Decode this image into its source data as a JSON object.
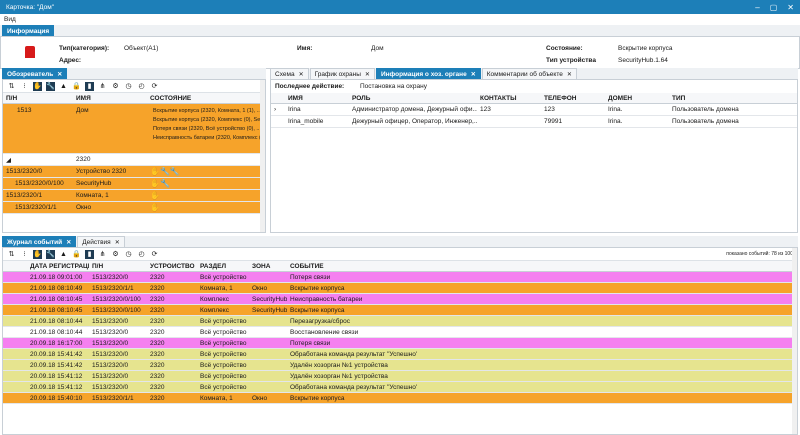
{
  "window": {
    "title": "Карточка: \"Дом\"",
    "min": "–",
    "max": "▢",
    "close": "✕"
  },
  "menu": {
    "view": "Вид"
  },
  "top_tab": {
    "label": "Информация"
  },
  "info": {
    "type_label": "Тип(категория):",
    "type_value": "Объект(А1)",
    "address_label": "Адрес:",
    "name_label": "Имя:",
    "name_value": "Дом",
    "state_label": "Состояние:",
    "state_value": "Вскрытие корпуса",
    "device_type_label": "Тип устройства",
    "device_type_value": "SecurityHub.1.64"
  },
  "left_tabs": [
    {
      "label": "Обозреватель",
      "close": "✕"
    }
  ],
  "right_tabs": [
    {
      "label": "Схема",
      "close": "✕"
    },
    {
      "label": "График охраны",
      "close": "✕"
    },
    {
      "label": "Информация о хоз. органе",
      "close": "✕"
    },
    {
      "label": "Комментарии об объекте",
      "close": "✕"
    }
  ],
  "tree": {
    "headers": [
      "П/Н",
      "ИМЯ",
      "СОСТОЯНИЕ"
    ],
    "rows": [
      {
        "num": "1513",
        "name": "Дом",
        "states": [
          "Вскрытие корпуса (2320, Комната, 1 (1), ...",
          "Вскрытие корпуса (2320, Комплекс (0), Se...",
          "Потеря связи (2320, Всё устройство (0), ...",
          "Неисправность батареи (2320, Комплекс (0)..."
        ],
        "color": "orange"
      },
      {
        "num": "",
        "name": "2320",
        "states": [],
        "color": "white"
      },
      {
        "num": "1513/2320/0",
        "name": "Устройство 2320",
        "states": [],
        "color": "orange"
      },
      {
        "num": "1513/2320/0/100",
        "name": "SecurityHub",
        "states": [],
        "color": "orange"
      },
      {
        "num": "1513/2320/1",
        "name": "Комната, 1",
        "states": [],
        "color": "orange"
      },
      {
        "num": "1513/2320/1/1",
        "name": "Окно",
        "states": [],
        "color": "orange"
      }
    ]
  },
  "last_action": {
    "label": "Последнее действие:",
    "value": "Постановка на охрану"
  },
  "contacts": {
    "headers": [
      "ИМЯ",
      "РОЛЬ",
      "КОНТАКТЫ",
      "ТЕЛЕФОН",
      "ДОМЕН",
      "ТИП"
    ],
    "rows": [
      [
        "Irina",
        "Администратор домена, Дежурный офи...",
        "123",
        "123",
        "Irina.",
        "Пользователь домена"
      ],
      [
        "Irina_mobile",
        "Дежурный офицер, Оператор, Инженер,...",
        "",
        "79991",
        "Irina.",
        "Пользователь домена"
      ]
    ]
  },
  "bottom_tabs": [
    {
      "label": "Журнал событий",
      "close": "✕"
    },
    {
      "label": "Действия",
      "close": "✕"
    }
  ],
  "events": {
    "shown": "показано событий: 78 из 100",
    "headers": [
      "ДАТА РЕГИСТРАЦИИ",
      "П/Н",
      "УСТРОЙСТВО",
      "РАЗДЕЛ",
      "ЗОНА",
      "СОБЫТИЕ"
    ],
    "rows": [
      {
        "c": [
          "21.09.18 09:01:00",
          "1513/2320/0",
          "2320",
          "Всё устройство",
          "",
          "Потеря связи"
        ],
        "color": "pink"
      },
      {
        "c": [
          "21.09.18 08:10:49",
          "1513/2320/1/1",
          "2320",
          "Комната, 1",
          "Окно",
          "Вскрытие корпуса"
        ],
        "color": "orange"
      },
      {
        "c": [
          "21.09.18 08:10:45",
          "1513/2320/0/100",
          "2320",
          "Комплекс",
          "SecurityHub",
          "Неисправность батареи"
        ],
        "color": "pink"
      },
      {
        "c": [
          "21.09.18 08:10:45",
          "1513/2320/0/100",
          "2320",
          "Комплекс",
          "SecurityHub",
          "Вскрытие корпуса"
        ],
        "color": "orange"
      },
      {
        "c": [
          "21.09.18 08:10:44",
          "1513/2320/0",
          "2320",
          "Всё устройство",
          "",
          "Перезагрузка/сброс"
        ],
        "color": "yellow"
      },
      {
        "c": [
          "21.09.18 08:10:44",
          "1513/2320/0",
          "2320",
          "Всё устройство",
          "",
          "Восстановление связи"
        ],
        "color": "white"
      },
      {
        "c": [
          "20.09.18 16:17:00",
          "1513/2320/0",
          "2320",
          "Всё устройство",
          "",
          "Потеря связи"
        ],
        "color": "pink"
      },
      {
        "c": [
          "20.09.18 15:41:42",
          "1513/2320/0",
          "2320",
          "Всё устройство",
          "",
          "Обработана команда результат \"Успешно\""
        ],
        "color": "yellow"
      },
      {
        "c": [
          "20.09.18 15:41:42",
          "1513/2320/0",
          "2320",
          "Всё устройство",
          "",
          "Удалён хозорган №1 устройства"
        ],
        "color": "yellow"
      },
      {
        "c": [
          "20.09.18 15:41:12",
          "1513/2320/0",
          "2320",
          "Всё устройство",
          "",
          "Удалён хозорган №1 устройства"
        ],
        "color": "yellow"
      },
      {
        "c": [
          "20.09.18 15:41:12",
          "1513/2320/0",
          "2320",
          "Всё устройство",
          "",
          "Обработана команда результат \"Успешно\""
        ],
        "color": "yellow"
      },
      {
        "c": [
          "20.09.18 15:40:10",
          "1513/2320/1/1",
          "2320",
          "Комната, 1",
          "Окно",
          "Вскрытие корпуса"
        ],
        "color": "orange"
      }
    ]
  }
}
